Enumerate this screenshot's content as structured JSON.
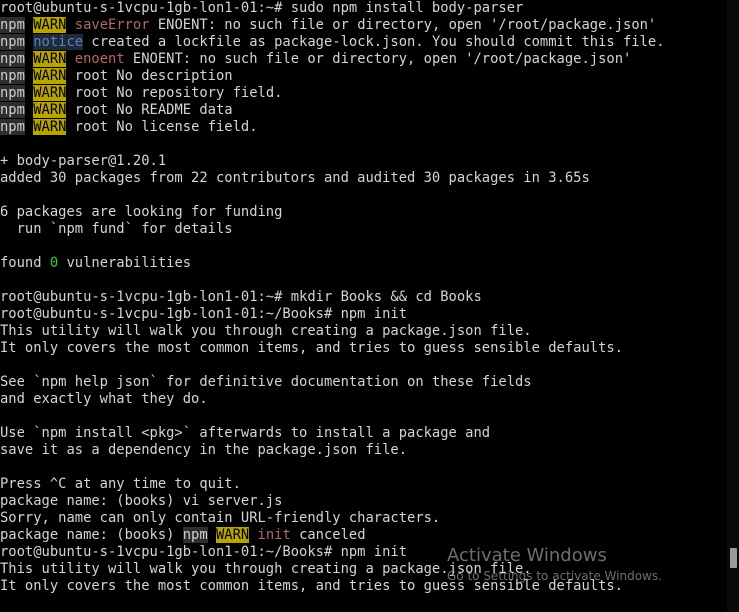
{
  "terminal": {
    "lines": [
      [
        {
          "t": "root@ubuntu-s-1vcpu-1gb-lon1-01:~# sudo npm install body-parser",
          "s": "normal"
        }
      ],
      [
        {
          "t": "npm",
          "s": "hl-warn"
        },
        {
          "t": " ",
          "s": "normal"
        },
        {
          "t": "WARN",
          "s": "warn"
        },
        {
          "t": " ",
          "s": "normal"
        },
        {
          "t": "saveError",
          "s": "dim"
        },
        {
          "t": " ENOENT: no such file or directory, open '/root/package.json'",
          "s": "normal"
        }
      ],
      [
        {
          "t": "npm",
          "s": "hl-warn"
        },
        {
          "t": " ",
          "s": "normal"
        },
        {
          "t": "notice",
          "s": "notice"
        },
        {
          "t": " created a lockfile as package-lock.json. You should commit this file.",
          "s": "normal"
        }
      ],
      [
        {
          "t": "npm",
          "s": "hl-warn"
        },
        {
          "t": " ",
          "s": "normal"
        },
        {
          "t": "WARN",
          "s": "warn"
        },
        {
          "t": " ",
          "s": "normal"
        },
        {
          "t": "enoent",
          "s": "dim"
        },
        {
          "t": " ENOENT: no such file or directory, open '/root/package.json'",
          "s": "normal"
        }
      ],
      [
        {
          "t": "npm",
          "s": "hl-warn"
        },
        {
          "t": " ",
          "s": "normal"
        },
        {
          "t": "WARN",
          "s": "warn"
        },
        {
          "t": " root No description",
          "s": "normal"
        }
      ],
      [
        {
          "t": "npm",
          "s": "hl-warn"
        },
        {
          "t": " ",
          "s": "normal"
        },
        {
          "t": "WARN",
          "s": "warn"
        },
        {
          "t": " root No repository field.",
          "s": "normal"
        }
      ],
      [
        {
          "t": "npm",
          "s": "hl-warn"
        },
        {
          "t": " ",
          "s": "normal"
        },
        {
          "t": "WARN",
          "s": "warn"
        },
        {
          "t": " root No README data",
          "s": "normal"
        }
      ],
      [
        {
          "t": "npm",
          "s": "hl-warn"
        },
        {
          "t": " ",
          "s": "normal"
        },
        {
          "t": "WARN",
          "s": "warn"
        },
        {
          "t": " root No license field.",
          "s": "normal"
        }
      ],
      [
        {
          "t": "",
          "s": "normal"
        }
      ],
      [
        {
          "t": "+ body-parser@1.20.1",
          "s": "normal"
        }
      ],
      [
        {
          "t": "added 30 packages from 22 contributors and audited 30 packages in 3.65s",
          "s": "normal"
        }
      ],
      [
        {
          "t": "",
          "s": "normal"
        }
      ],
      [
        {
          "t": "6 packages are looking for funding",
          "s": "normal"
        }
      ],
      [
        {
          "t": "  run `npm fund` for details",
          "s": "normal"
        }
      ],
      [
        {
          "t": "",
          "s": "normal"
        }
      ],
      [
        {
          "t": "found ",
          "s": "normal"
        },
        {
          "t": "0",
          "s": "green"
        },
        {
          "t": " vulnerabilities",
          "s": "normal"
        }
      ],
      [
        {
          "t": "",
          "s": "normal"
        }
      ],
      [
        {
          "t": "root@ubuntu-s-1vcpu-1gb-lon1-01:~# mkdir Books && cd Books",
          "s": "normal"
        }
      ],
      [
        {
          "t": "root@ubuntu-s-1vcpu-1gb-lon1-01:~/Books# npm init",
          "s": "normal"
        }
      ],
      [
        {
          "t": "This utility will walk you through creating a package.json file.",
          "s": "normal"
        }
      ],
      [
        {
          "t": "It only covers the most common items, and tries to guess sensible defaults.",
          "s": "normal"
        }
      ],
      [
        {
          "t": "",
          "s": "normal"
        }
      ],
      [
        {
          "t": "See `npm help json` for definitive documentation on these fields",
          "s": "normal"
        }
      ],
      [
        {
          "t": "and exactly what they do.",
          "s": "normal"
        }
      ],
      [
        {
          "t": "",
          "s": "normal"
        }
      ],
      [
        {
          "t": "Use `npm install <pkg>` afterwards to install a package and",
          "s": "normal"
        }
      ],
      [
        {
          "t": "save it as a dependency in the package.json file.",
          "s": "normal"
        }
      ],
      [
        {
          "t": "",
          "s": "normal"
        }
      ],
      [
        {
          "t": "Press ^C at any time to quit.",
          "s": "normal"
        }
      ],
      [
        {
          "t": "package name: (books) vi server.js",
          "s": "normal"
        }
      ],
      [
        {
          "t": "Sorry, name can only contain URL-friendly characters.",
          "s": "normal"
        }
      ],
      [
        {
          "t": "package name: (books) ",
          "s": "normal"
        },
        {
          "t": "npm",
          "s": "hl-warn"
        },
        {
          "t": " ",
          "s": "normal"
        },
        {
          "t": "WARN",
          "s": "warn"
        },
        {
          "t": " ",
          "s": "normal"
        },
        {
          "t": "init",
          "s": "dim"
        },
        {
          "t": " canceled",
          "s": "normal"
        }
      ],
      [
        {
          "t": "root@ubuntu-s-1vcpu-1gb-lon1-01:~/Books# npm init",
          "s": "normal"
        }
      ],
      [
        {
          "t": "This utility will walk you through creating a package.json file.",
          "s": "normal"
        }
      ],
      [
        {
          "t": "It only covers the most common items, and tries to guess sensible defaults.",
          "s": "normal"
        }
      ]
    ]
  },
  "watermark": {
    "title": "Activate Windows",
    "subtitle": "Go to Settings to activate Windows."
  }
}
